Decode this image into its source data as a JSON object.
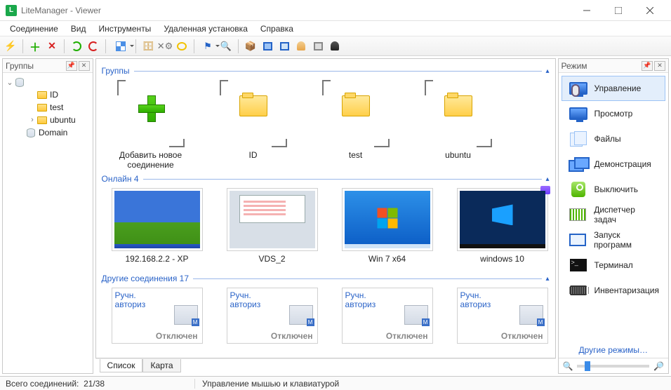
{
  "window": {
    "title": "LiteManager - Viewer"
  },
  "menu": {
    "items": [
      "Соединение",
      "Вид",
      "Инструменты",
      "Удаленная установка",
      "Справка"
    ]
  },
  "left_panel": {
    "title": "Группы",
    "tree": [
      {
        "label": "ID",
        "depth": 2,
        "icon": "folder",
        "expander": ""
      },
      {
        "label": "test",
        "depth": 2,
        "icon": "folder",
        "expander": ""
      },
      {
        "label": "ubuntu",
        "depth": 2,
        "icon": "folder",
        "expander": "›"
      },
      {
        "label": "Domain",
        "depth": 1,
        "icon": "db",
        "expander": ""
      }
    ]
  },
  "center": {
    "sections": {
      "groups": {
        "title": "Группы",
        "items": [
          {
            "label": "Добавить новое соединение",
            "kind": "add"
          },
          {
            "label": "ID",
            "kind": "folder"
          },
          {
            "label": "test",
            "kind": "folder"
          },
          {
            "label": "ubuntu",
            "kind": "folder"
          }
        ]
      },
      "online": {
        "title": "Онлайн 4",
        "items": [
          {
            "label": "192.168.2.2 - XP",
            "thumb": "xp"
          },
          {
            "label": "VDS_2",
            "thumb": "vds"
          },
          {
            "label": "Win 7 x64",
            "thumb": "w7"
          },
          {
            "label": "windows 10",
            "thumb": "w10",
            "badge": true
          }
        ]
      },
      "other": {
        "title": "Другие соединения 17",
        "auth_text": "Ручн. авториз",
        "status_text": "Отключен",
        "count": 4
      }
    },
    "tabs": [
      "Список",
      "Карта"
    ],
    "active_tab": 0
  },
  "right_panel": {
    "title": "Режим",
    "modes": [
      {
        "label": "Управление",
        "icon": "ico-monitor",
        "overlay": "ico-mouse"
      },
      {
        "label": "Просмотр",
        "icon": "ico-monitor"
      },
      {
        "label": "Файлы",
        "icon": "ico-files"
      },
      {
        "label": "Демонстрация",
        "icon": "ico-demo"
      },
      {
        "label": "Выключить",
        "icon": "ico-power"
      },
      {
        "label": "Диспетчер задач",
        "icon": "ico-task"
      },
      {
        "label": "Запуск программ",
        "icon": "ico-run"
      },
      {
        "label": "Терминал",
        "icon": "ico-term"
      },
      {
        "label": "Инвентаризация",
        "icon": "ico-chip"
      }
    ],
    "more_label": "Другие режимы…"
  },
  "status": {
    "connections_label": "Всего соединений:",
    "connections_value": "21/38",
    "hint": "Управление мышью и клавиатурой"
  }
}
